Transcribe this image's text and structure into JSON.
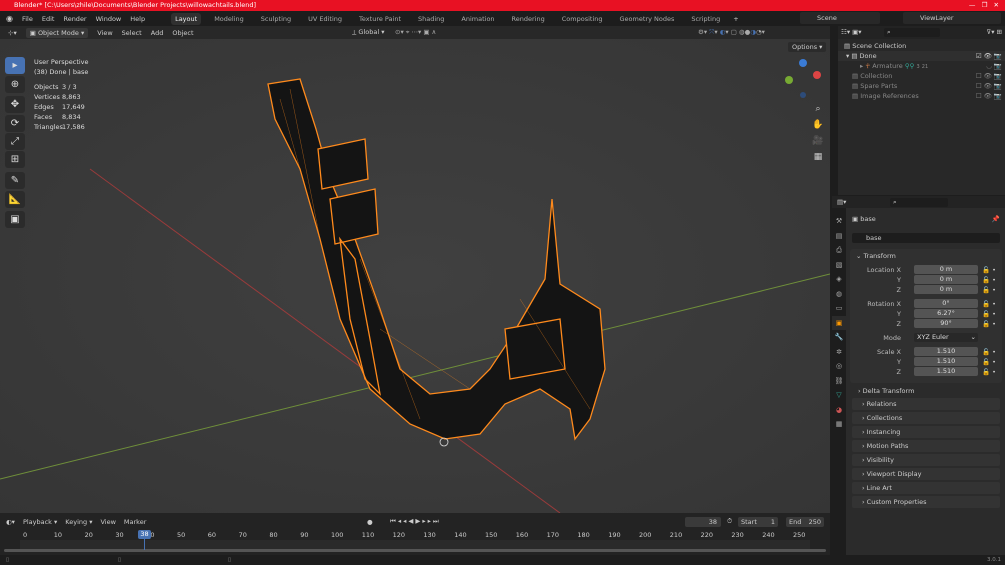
{
  "title": "Blender* [C:\\Users\\zhile\\Documents\\Blender Projects\\willowachtails.blend]",
  "menu": [
    "File",
    "Edit",
    "Render",
    "Window",
    "Help"
  ],
  "workspaces": [
    "Layout",
    "Modeling",
    "Sculpting",
    "UV Editing",
    "Texture Paint",
    "Shading",
    "Animation",
    "Rendering",
    "Compositing",
    "Geometry Nodes",
    "Scripting"
  ],
  "active_workspace": "Layout",
  "scene": "Scene",
  "view_layer": "ViewLayer",
  "viewport_header": {
    "mode": "Object Mode",
    "menus": [
      "View",
      "Select",
      "Add",
      "Object"
    ],
    "orientation": "Global",
    "options": "Options"
  },
  "overlay": {
    "perspective": "User Perspective",
    "context": "(38) Done | base",
    "stats": [
      [
        "Objects",
        "3 / 3"
      ],
      [
        "Vertices",
        "8,863"
      ],
      [
        "Edges",
        "17,649"
      ],
      [
        "Faces",
        "8,834"
      ],
      [
        "Triangles",
        "17,586"
      ]
    ]
  },
  "outliner": {
    "root": "Scene Collection",
    "items": [
      "Done",
      "Armature",
      "Collection",
      "Spare Parts",
      "Image References"
    ],
    "badges": [
      "3",
      "21"
    ]
  },
  "properties": {
    "object_name": "base",
    "data_name": "base",
    "transform": "Transform",
    "location": {
      "label": "Location X",
      "x": "0 m",
      "y": "0 m",
      "z": "0 m"
    },
    "rotation": {
      "label": "Rotation X",
      "x": "0°",
      "y": "6.27°",
      "z": "90°"
    },
    "mode_label": "Mode",
    "mode": "XYZ Euler",
    "scale": {
      "label": "Scale X",
      "x": "1.510",
      "y": "1.510",
      "z": "1.510"
    },
    "axis": {
      "y": "Y",
      "z": "Z"
    },
    "panels": [
      "Delta Transform",
      "Relations",
      "Collections",
      "Instancing",
      "Motion Paths",
      "Visibility",
      "Viewport Display",
      "Line Art",
      "Custom Properties"
    ]
  },
  "timeline": {
    "menus": [
      "Playback",
      "Keying",
      "View",
      "Marker"
    ],
    "current": "38",
    "start_label": "Start",
    "start": "1",
    "end_label": "End",
    "end": "250",
    "ticks": [
      "0",
      "10",
      "20",
      "30",
      "40",
      "50",
      "60",
      "70",
      "80",
      "90",
      "100",
      "110",
      "120",
      "130",
      "140",
      "150",
      "160",
      "170",
      "180",
      "190",
      "200",
      "210",
      "220",
      "230",
      "240",
      "250"
    ]
  },
  "version": "3.0.1",
  "colors": {
    "accent": "#4772b3",
    "titlebar": "#e81123",
    "wire": "#ff8a1c"
  }
}
